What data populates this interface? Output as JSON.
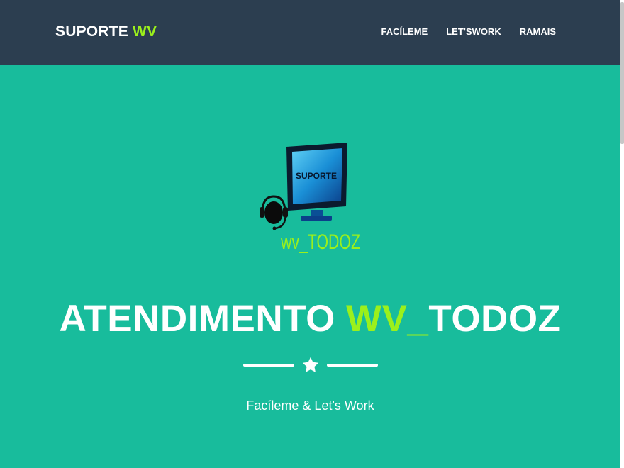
{
  "navbar": {
    "brand_main": "SUPORTE",
    "brand_accent": "WV",
    "links": [
      "FACÍLEME",
      "LET'SWORK",
      "RAMAIS"
    ]
  },
  "hero": {
    "logo": {
      "monitor_text": "SUPORTE",
      "caption": "wv_TODOZ",
      "icons": [
        "monitor-icon",
        "headset-icon"
      ]
    },
    "headline_main": "ATENDIMENTO",
    "headline_accent": "WV_",
    "headline_tail": "TODOZ",
    "divider_icon": "star-icon",
    "tagline": "Facíleme & Let's Work"
  },
  "colors": {
    "background": "#18bc9c",
    "navbar": "#2c3e50",
    "accent": "#9bf01c",
    "text": "#ffffff"
  }
}
